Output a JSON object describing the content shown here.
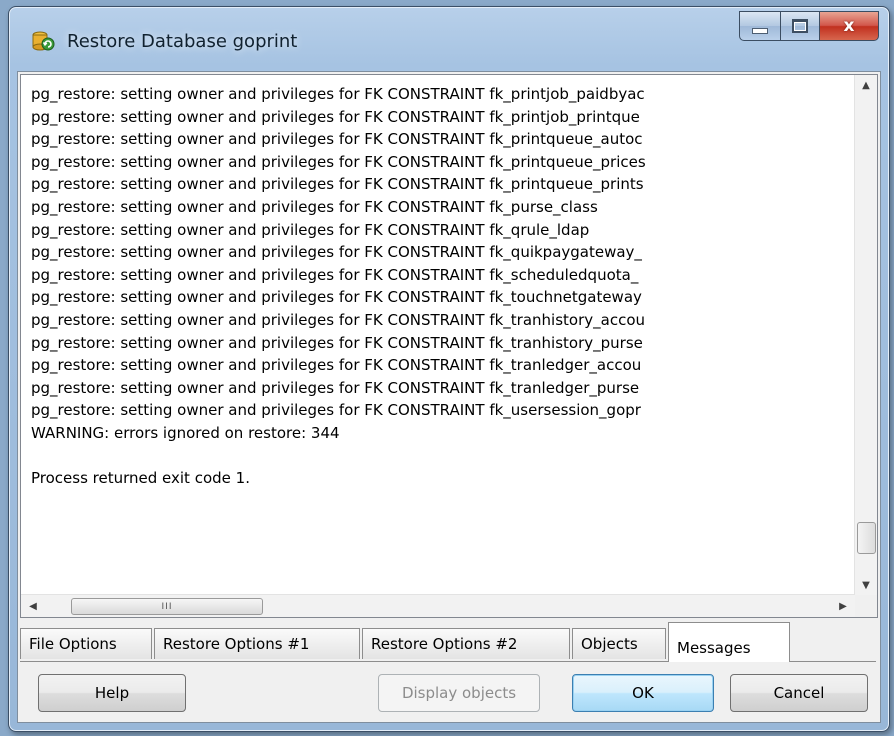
{
  "window": {
    "title": "Restore Database goprint",
    "controls": {
      "minimize": "minimize",
      "maximize": "maximize",
      "close": "x"
    }
  },
  "log": {
    "lines": [
      "pg_restore: setting owner and privileges for FK CONSTRAINT fk_printjob_paidbyac",
      "pg_restore: setting owner and privileges for FK CONSTRAINT fk_printjob_printque",
      "pg_restore: setting owner and privileges for FK CONSTRAINT fk_printqueue_autoc",
      "pg_restore: setting owner and privileges for FK CONSTRAINT fk_printqueue_prices",
      "pg_restore: setting owner and privileges for FK CONSTRAINT fk_printqueue_prints",
      "pg_restore: setting owner and privileges for FK CONSTRAINT fk_purse_class",
      "pg_restore: setting owner and privileges for FK CONSTRAINT fk_qrule_ldap",
      "pg_restore: setting owner and privileges for FK CONSTRAINT fk_quikpaygateway_",
      "pg_restore: setting owner and privileges for FK CONSTRAINT fk_scheduledquota_",
      "pg_restore: setting owner and privileges for FK CONSTRAINT fk_touchnetgateway",
      "pg_restore: setting owner and privileges for FK CONSTRAINT fk_tranhistory_accou",
      "pg_restore: setting owner and privileges for FK CONSTRAINT fk_tranhistory_purse",
      "pg_restore: setting owner and privileges for FK CONSTRAINT fk_tranledger_accou",
      "pg_restore: setting owner and privileges for FK CONSTRAINT fk_tranledger_purse",
      "pg_restore: setting owner and privileges for FK CONSTRAINT fk_usersession_gopr",
      "WARNING: errors ignored on restore: 344",
      "",
      "Process returned exit code 1."
    ],
    "hscroll_thumb_grip": "III"
  },
  "tabs": [
    {
      "label": "File Options",
      "selected": false
    },
    {
      "label": "Restore Options #1",
      "selected": false
    },
    {
      "label": "Restore Options #2",
      "selected": false
    },
    {
      "label": "Objects",
      "selected": false
    },
    {
      "label": "Messages",
      "selected": true
    }
  ],
  "buttons": {
    "help": "Help",
    "display_objects": "Display objects",
    "ok": "OK",
    "cancel": "Cancel"
  },
  "icons": {
    "app": "database-restore-icon",
    "scroll_up": "scroll-up-arrow-icon",
    "scroll_down": "scroll-down-arrow-icon",
    "scroll_left": "scroll-left-arrow-icon",
    "scroll_right": "scroll-right-arrow-icon"
  }
}
